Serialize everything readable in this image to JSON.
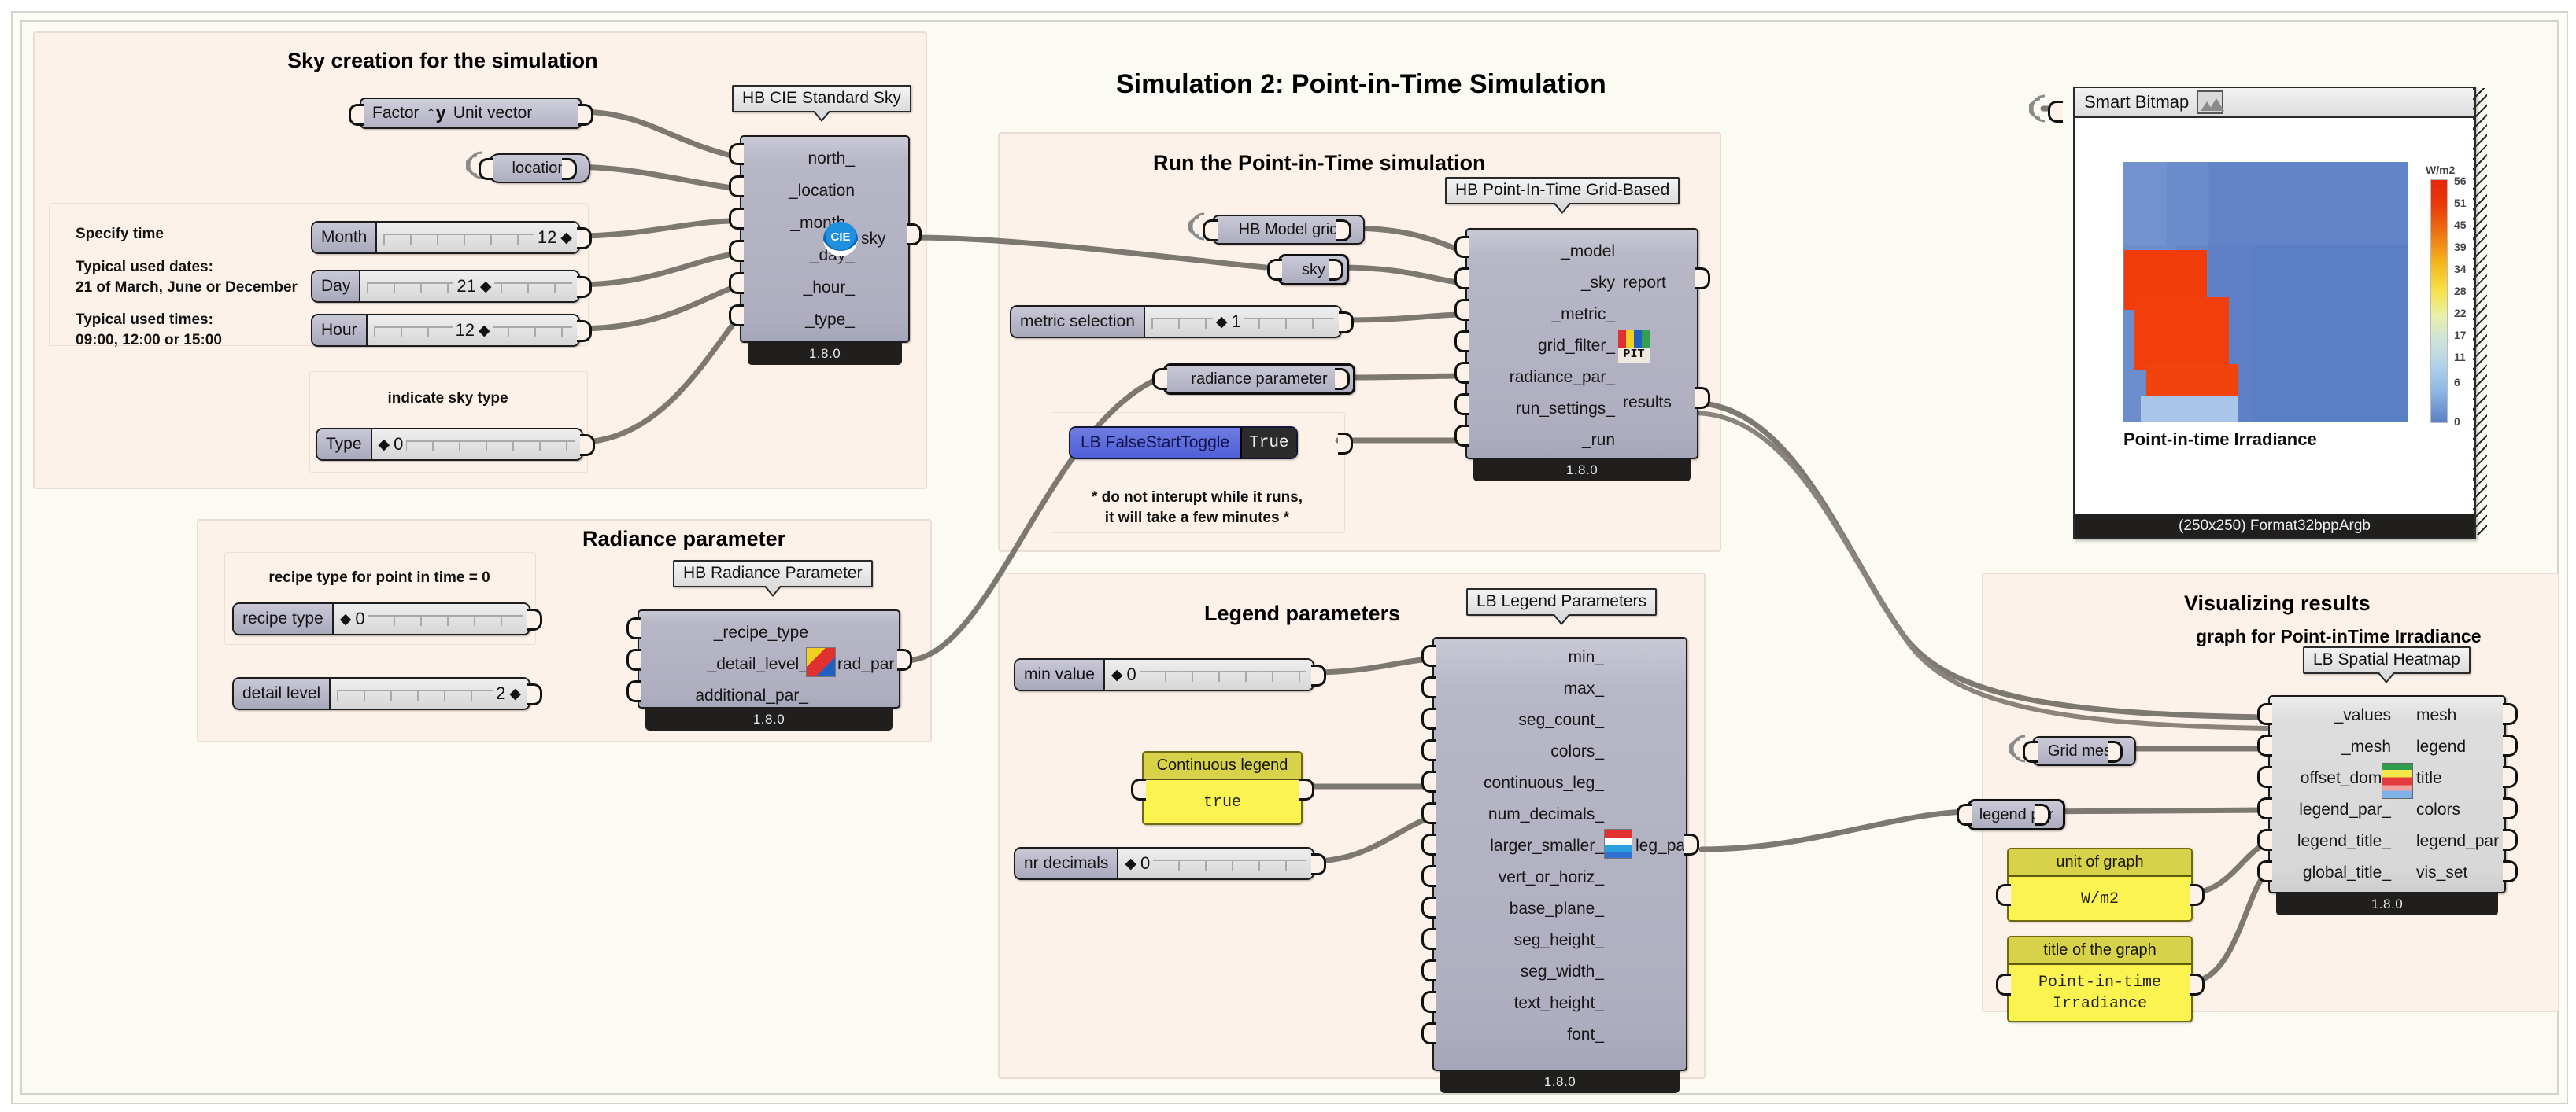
{
  "canvas": {
    "title": "Simulation 2: Point-in-Time Simulation"
  },
  "groups": {
    "sky": {
      "title": "Sky creation for the simulation",
      "unit_vector": {
        "factor_label": "Factor",
        "name_label": "Unit vector",
        "icon": "y-axis-vector-icon"
      },
      "location_param": "location",
      "time_box": {
        "specify_time": "Specify time",
        "dates_note": "Typical used dates:\n21 of March, June or December",
        "times_note": "Typical used times:\n09:00, 12:00 or 15:00",
        "month": {
          "name": "Month",
          "value": "12"
        },
        "day": {
          "name": "Day",
          "value": "21"
        },
        "hour": {
          "name": "Hour",
          "value": "12"
        }
      },
      "type_box": {
        "caption": "indicate sky type",
        "type": {
          "name": "Type",
          "value": "0"
        }
      },
      "node": {
        "nickname": "HB CIE Standard Sky",
        "version": "1.8.0",
        "inputs": [
          "north_",
          "_location",
          "_month_",
          "_day_",
          "_hour_",
          "_type_"
        ],
        "outputs": [
          "sky"
        ],
        "icon": "cie-sky-icon"
      }
    },
    "radiance": {
      "title": "Radiance parameter",
      "recipe_box": {
        "caption": "recipe type for point in time = 0",
        "recipe": {
          "name": "recipe type",
          "value": "0"
        }
      },
      "detail": {
        "name": "detail level",
        "value": "2"
      },
      "node": {
        "nickname": "HB Radiance Parameter",
        "version": "1.8.0",
        "inputs": [
          "_recipe_type",
          "_detail_level_",
          "additional_par_"
        ],
        "outputs": [
          "rad_par"
        ],
        "icon": "radiance-parameter-icon"
      }
    },
    "run": {
      "title": "Run the Point-in-Time simulation",
      "model_grid": "HB Model grid",
      "sky_param": "sky",
      "metric": {
        "name": "metric selection",
        "value": "1"
      },
      "radiance_param": "radiance parameter",
      "toggle_box": {
        "toggle_label": "LB FalseStartToggle",
        "toggle_state": "True",
        "warning": "* do not interupt while it runs,\nit will take a few minutes *"
      },
      "node": {
        "nickname": "HB Point-In-Time Grid-Based",
        "version": "1.8.0",
        "inputs": [
          "_model",
          "_sky",
          "_metric_",
          "grid_filter_",
          "radiance_par_",
          "run_settings_",
          "_run"
        ],
        "outputs": [
          "report",
          "results"
        ],
        "icon": "pit-icon"
      }
    },
    "legend": {
      "title": "Legend parameters",
      "min_value": {
        "name": "min value",
        "value": "0"
      },
      "continuous": {
        "header": "Continuous legend",
        "value": "true"
      },
      "nr_decimals": {
        "name": "nr decimals",
        "value": "0"
      },
      "node": {
        "nickname": "LB Legend Parameters",
        "version": "1.8.0",
        "inputs": [
          "min_",
          "max_",
          "seg_count_",
          "colors_",
          "continuous_leg_",
          "num_decimals_",
          "larger_smaller_",
          "vert_or_horiz_",
          "base_plane_",
          "seg_height_",
          "seg_width_",
          "text_height_",
          "font_"
        ],
        "outputs": [
          "leg_par"
        ],
        "icon": "legend-parameters-icon"
      }
    },
    "visualize": {
      "title": "Visualizing results",
      "subtitle": "graph for Point-inTime Irradiance",
      "grid_mesh": "Grid mesh",
      "legend_par": "legend par",
      "unit_panel": {
        "header": "unit of graph",
        "value": "W/m2"
      },
      "title_panel": {
        "header": "title of the graph",
        "value": "Point-in-time\nIrradiance"
      },
      "node": {
        "nickname": "LB Spatial Heatmap",
        "version": "1.8.0",
        "inputs": [
          "_values",
          "_mesh",
          "offset_dom_",
          "legend_par_",
          "legend_title_",
          "global_title_"
        ],
        "outputs": [
          "mesh",
          "legend",
          "title",
          "colors",
          "legend_par",
          "vis_set"
        ],
        "icon": "spatial-heatmap-icon"
      }
    }
  },
  "bitmap": {
    "header": "Smart Bitmap",
    "icon": "image-thumbnail-icon",
    "caption": "Point-in-time Irradiance",
    "footer": "(250x250) Format32bppArgb"
  },
  "chart_data": {
    "type": "heatmap",
    "title": "Point-in-time Irradiance",
    "legend_title": "W/m2",
    "legend_ticks": [
      "56",
      "51",
      "45",
      "39",
      "34",
      "28",
      "22",
      "17",
      "11",
      "6",
      "0"
    ],
    "value_min": 0,
    "value_max": 56,
    "unit": "W/m2",
    "colors": [
      "#5a7fc4",
      "#8ab4e3",
      "#b4d3ea",
      "#cfe3d8",
      "#e9f0a8",
      "#f8e24a",
      "#f5b41c",
      "#ee7412",
      "#e8390a",
      "#e8260a"
    ],
    "description": "Spatial grid heatmap: large mid-blue background (~0-11 W/m2) with a bright orange-red L-shaped patch (~50-56 W/m2) occupying the left-center region.",
    "cells": [
      [
        7,
        7,
        7,
        7,
        7,
        8,
        8,
        8,
        9,
        9,
        9,
        9,
        9,
        9,
        9,
        9
      ],
      [
        7,
        7,
        7,
        7,
        7,
        8,
        8,
        8,
        9,
        9,
        9,
        9,
        9,
        9,
        9,
        9
      ],
      [
        7,
        7,
        7,
        7,
        7,
        8,
        8,
        8,
        9,
        9,
        9,
        9,
        9,
        9,
        9,
        9
      ],
      [
        7,
        7,
        7,
        7,
        7,
        8,
        8,
        8,
        9,
        9,
        9,
        9,
        9,
        9,
        9,
        9
      ],
      [
        8,
        8,
        8,
        8,
        8,
        8,
        8,
        9,
        9,
        9,
        9,
        9,
        9,
        9,
        9,
        9
      ],
      [
        54,
        54,
        54,
        54,
        54,
        9,
        9,
        9,
        9,
        9,
        9,
        9,
        9,
        9,
        9,
        9
      ],
      [
        54,
        54,
        54,
        54,
        54,
        9,
        9,
        9,
        9,
        9,
        9,
        9,
        9,
        9,
        9,
        9
      ],
      [
        54,
        54,
        54,
        54,
        54,
        9,
        9,
        9,
        9,
        9,
        9,
        9,
        9,
        9,
        9,
        9
      ],
      [
        8,
        54,
        54,
        54,
        54,
        54,
        9,
        9,
        9,
        9,
        9,
        9,
        9,
        9,
        9,
        9
      ],
      [
        54,
        54,
        54,
        54,
        54,
        54,
        9,
        9,
        9,
        9,
        9,
        9,
        9,
        9,
        9,
        9
      ],
      [
        54,
        54,
        54,
        54,
        54,
        54,
        9,
        9,
        9,
        9,
        9,
        9,
        9,
        9,
        9,
        9
      ],
      [
        54,
        54,
        54,
        54,
        54,
        54,
        9,
        9,
        9,
        9,
        9,
        9,
        9,
        9,
        9,
        9
      ],
      [
        54,
        54,
        54,
        54,
        54,
        54,
        9,
        9,
        9,
        9,
        9,
        9,
        9,
        9,
        9,
        9
      ],
      [
        8,
        54,
        54,
        54,
        54,
        54,
        54,
        8,
        8,
        8,
        9,
        9,
        9,
        9,
        9,
        9
      ],
      [
        6,
        54,
        54,
        54,
        54,
        54,
        54,
        6,
        6,
        6,
        9,
        9,
        9,
        9,
        9,
        9
      ],
      [
        6,
        6,
        6,
        6,
        6,
        6,
        6,
        6,
        6,
        6,
        9,
        9,
        9,
        9,
        9,
        9
      ]
    ]
  }
}
